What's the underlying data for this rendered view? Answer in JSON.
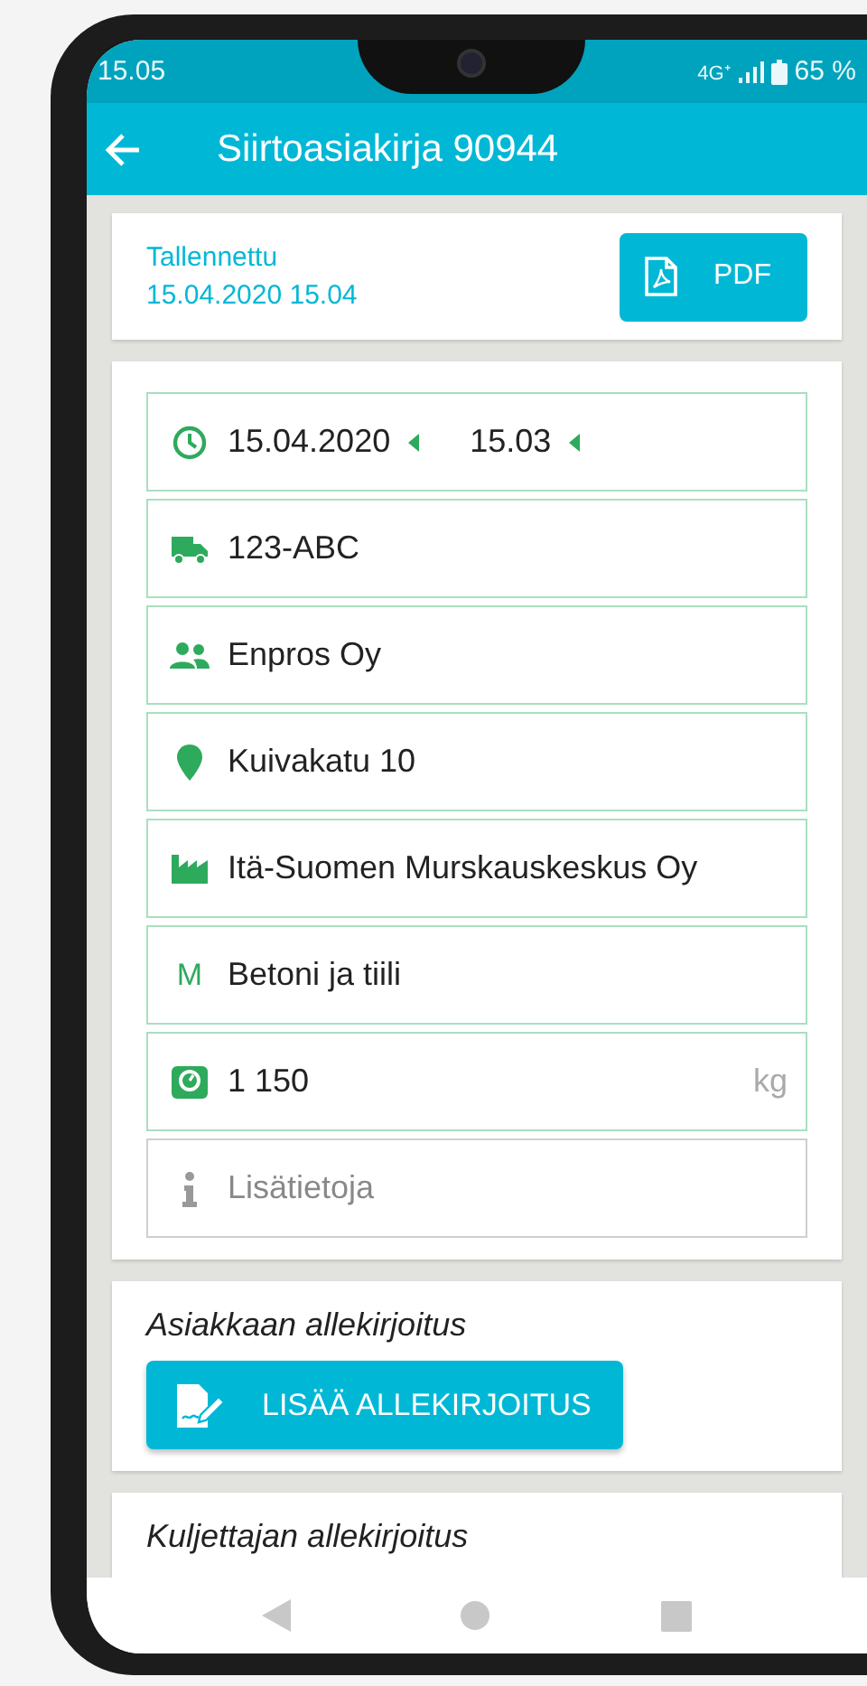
{
  "status_bar": {
    "time": "15.05",
    "network": "4G⁺",
    "battery": "65 %"
  },
  "app_bar": {
    "title": "Siirtoasiakirja 90944"
  },
  "saved_card": {
    "label": "Tallennettu",
    "datetime": "15.04.2020 15.04",
    "button": "PDF"
  },
  "fields": [
    {
      "kind": "datetime",
      "date": "15.04.2020",
      "time": "15.03"
    },
    {
      "kind": "vehicle",
      "value": "123-ABC"
    },
    {
      "kind": "customer",
      "value": "Enpros Oy"
    },
    {
      "kind": "address",
      "value": "Kuivakatu 10"
    },
    {
      "kind": "site",
      "value": "Itä-Suomen Murskauskeskus Oy"
    },
    {
      "kind": "material",
      "icon_text": "M",
      "value": "Betoni ja tiili"
    },
    {
      "kind": "weight",
      "value": "1 150",
      "unit": "kg"
    },
    {
      "kind": "notes",
      "placeholder": "Lisätietoja"
    }
  ],
  "signatures": [
    {
      "title": "Asiakkaan allekirjoitus",
      "button": "LISÄÄ ALLEKIRJOITUS"
    },
    {
      "title": "Kuljettajan allekirjoitus"
    }
  ]
}
